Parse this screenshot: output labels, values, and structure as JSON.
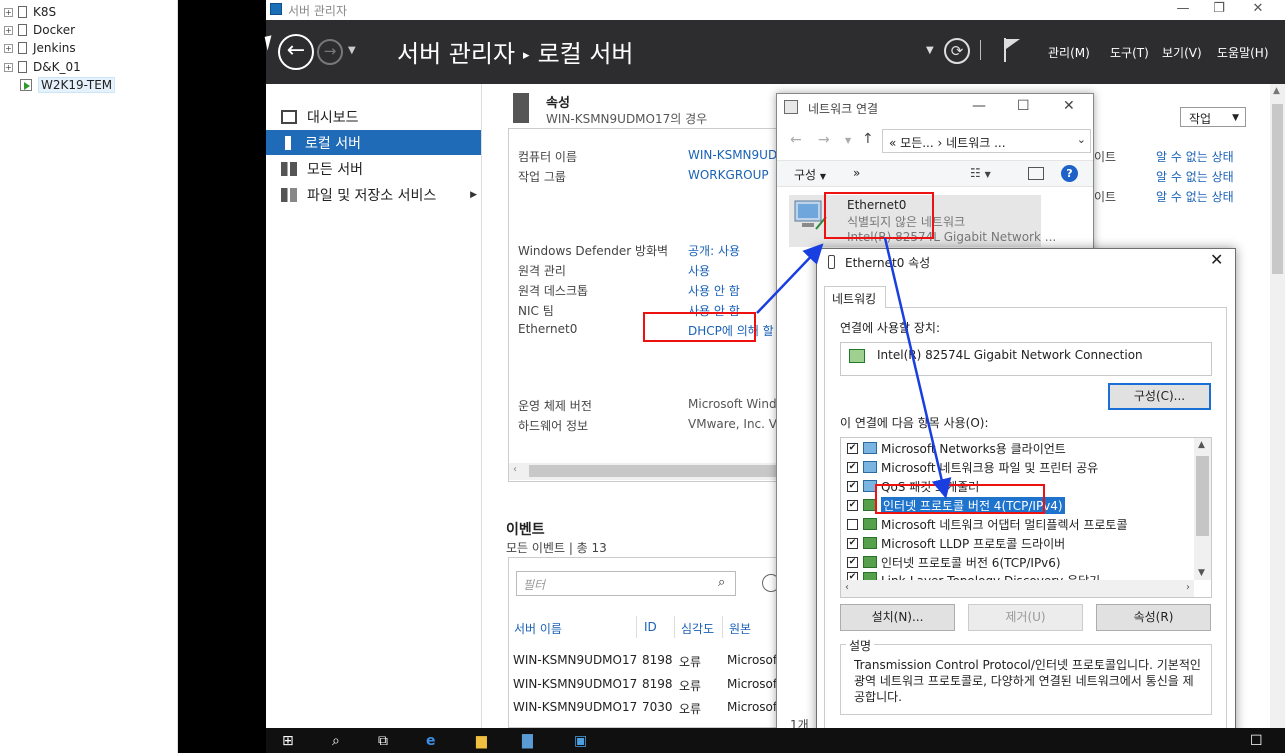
{
  "tree": {
    "items": [
      {
        "label": "K8S"
      },
      {
        "label": "Docker"
      },
      {
        "label": "Jenkins"
      },
      {
        "label": "D&K_01"
      }
    ],
    "selected_vm": "W2K19-TEM"
  },
  "server_manager": {
    "window_title": "서버 관리자",
    "breadcrumb": {
      "root": "서버 관리자",
      "sep": "▸",
      "current": "로컬 서버"
    },
    "menus": [
      "관리(M)",
      "도구(T)",
      "보기(V)",
      "도움말(H)"
    ],
    "nav": [
      {
        "label": "대시보드"
      },
      {
        "label": "로컬 서버"
      },
      {
        "label": "모든 서버"
      },
      {
        "label": "파일 및 저장소 서비스"
      }
    ],
    "properties": {
      "heading": "속성",
      "subheading": "WIN-KSMN9UDMO17의 경우",
      "rows": [
        {
          "label": "컴퓨터 이름",
          "value": "WIN-KSMN9UD"
        },
        {
          "label": "작업 그룹",
          "value": "WORKGROUP"
        },
        {
          "label": "Windows Defender 방화벽",
          "value": "공개: 사용"
        },
        {
          "label": "원격 관리",
          "value": "사용"
        },
        {
          "label": "원격 데스크톱",
          "value": "사용 안 함"
        },
        {
          "label": "NIC 팀",
          "value": "사용 안 함"
        },
        {
          "label": "Ethernet0",
          "value": "DHCP에 의해 할"
        },
        {
          "label": "운영 체제 버전",
          "value": "Microsoft Windo"
        },
        {
          "label": "하드웨어 정보",
          "value": "VMware, Inc. VM"
        }
      ],
      "right_frag_labels": [
        "이트",
        "이트"
      ],
      "right_status": [
        "알 수 없는 상태",
        "알 수 없는 상태",
        "알 수 없는 상태"
      ],
      "task_button": "작업"
    },
    "events": {
      "heading": "이벤트",
      "subheading": "모든 이벤트 | 총 13",
      "filter_placeholder": "필터",
      "columns": [
        "서버 이름",
        "ID",
        "심각도",
        "원본"
      ],
      "rows": [
        [
          "WIN-KSMN9UDMO17",
          "8198",
          "오류",
          "Microsof"
        ],
        [
          "WIN-KSMN9UDMO17",
          "8198",
          "오류",
          "Microsof"
        ],
        [
          "WIN-KSMN9UDMO17",
          "7030",
          "오류",
          "Microsof"
        ]
      ]
    }
  },
  "network_connections": {
    "title": "네트워크 연결",
    "address": "« 모든...  ›  네트워크 ...",
    "toolbar": {
      "organize": "구성",
      "more": "»"
    },
    "adapter": {
      "name": "Ethernet0",
      "network": "식별되지 않은 네트워크",
      "device": "Intel(R) 82574L Gigabit Network ..."
    },
    "status": "1개 "
  },
  "ethernet_properties": {
    "title": "Ethernet0 속성",
    "tab": "네트워킹",
    "connect_using_label": "연결에 사용할 장치:",
    "device": "Intel(R) 82574L Gigabit Network Connection",
    "configure_button": "구성(C)...",
    "items_label": "이 연결에 다음 항목 사용(O):",
    "items": [
      {
        "label": "Microsoft Networks용 클라이언트",
        "checked": true
      },
      {
        "label": "Microsoft 네트워크용 파일 및 프린터 공유",
        "checked": true
      },
      {
        "label": "QoS 패킷 스케줄러",
        "checked": true
      },
      {
        "label": "인터넷 프로토콜 버전 4(TCP/IPv4)",
        "checked": true
      },
      {
        "label": "Microsoft 네트워크 어댑터 멀티플렉서 프로토콜",
        "checked": false
      },
      {
        "label": "Microsoft LLDP 프로토콜 드라이버",
        "checked": true
      },
      {
        "label": "인터넷 프로토콜 버전 6(TCP/IPv6)",
        "checked": true
      },
      {
        "label": "Link-Layer Topology Discovery 응답기",
        "checked": true
      }
    ],
    "buttons": {
      "install": "설치(N)...",
      "uninstall": "제거(U)",
      "properties": "속성(R)"
    },
    "description_label": "설명",
    "description": "Transmission Control Protocol/인터넷 프로토콜입니다. 기본적인 광역 네트워크 프로토콜로, 다양하게 연결된 네트워크에서 통신을 제공합니다."
  },
  "colors": {
    "annotation_red": "#e11111",
    "annotation_arrow": "#1a3fe0",
    "nav_active": "#1f6bb8",
    "link_blue": "#1a62b6",
    "header_dark": "#2d2d30"
  }
}
